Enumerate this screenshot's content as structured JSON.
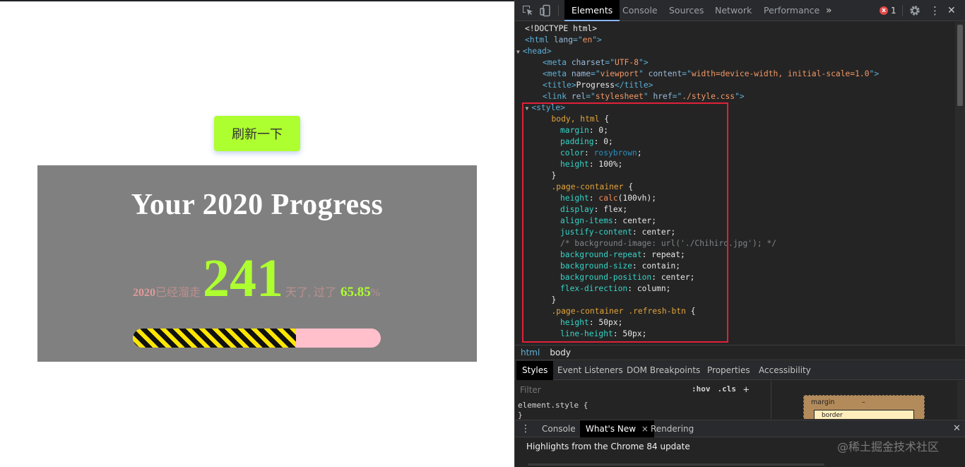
{
  "page": {
    "refresh_label": "刷新一下",
    "title": "Your 2020 Progress",
    "year": "2020",
    "elapsed_prefix": "已经溜走",
    "days": "241",
    "days_suffix": "天了, 过了",
    "percent": "65.85",
    "percent_sign": "%",
    "progress_fraction": 0.6585
  },
  "devtools": {
    "tabs": [
      "Elements",
      "Console",
      "Sources",
      "Network",
      "Performance"
    ],
    "more": "»",
    "error_count": "1",
    "error_symbol": "x",
    "more_menu": "⋮",
    "close": "✕",
    "code_lines": [
      [
        {
          "t": "<!DOCTYPE html>",
          "c": "pv"
        }
      ],
      [
        {
          "t": "<html ",
          "c": "tag"
        },
        {
          "t": "lang",
          "c": "attr"
        },
        {
          "t": "=\"",
          "c": "tag"
        },
        {
          "t": "en",
          "c": "val"
        },
        {
          "t": "\">",
          "c": "tag"
        }
      ],
      [
        {
          "t": "▼",
          "c": "arrow"
        },
        {
          "t": "<head>",
          "c": "tag"
        }
      ],
      [
        {
          "t": "<meta ",
          "c": "tag"
        },
        {
          "t": "charset",
          "c": "attr"
        },
        {
          "t": "=\"",
          "c": "tag"
        },
        {
          "t": "UTF-8",
          "c": "val"
        },
        {
          "t": "\">",
          "c": "tag"
        }
      ],
      [
        {
          "t": "<meta ",
          "c": "tag"
        },
        {
          "t": "name",
          "c": "attr"
        },
        {
          "t": "=\"",
          "c": "tag"
        },
        {
          "t": "viewport",
          "c": "val"
        },
        {
          "t": "\" ",
          "c": "tag"
        },
        {
          "t": "content",
          "c": "attr"
        },
        {
          "t": "=\"",
          "c": "tag"
        },
        {
          "t": "width=device-width, initial-scale=1.0",
          "c": "val"
        },
        {
          "t": "\">",
          "c": "tag"
        }
      ],
      [
        {
          "t": "<title>",
          "c": "tag"
        },
        {
          "t": "Progress",
          "c": "pv"
        },
        {
          "t": "</title>",
          "c": "tag"
        }
      ],
      [
        {
          "t": "<link ",
          "c": "tag"
        },
        {
          "t": "rel",
          "c": "attr"
        },
        {
          "t": "=\"",
          "c": "tag"
        },
        {
          "t": "stylesheet",
          "c": "val"
        },
        {
          "t": "\" ",
          "c": "tag"
        },
        {
          "t": "href",
          "c": "attr"
        },
        {
          "t": "=\"",
          "c": "tag"
        },
        {
          "t": "./style.css",
          "c": "val"
        },
        {
          "t": "\">",
          "c": "tag"
        }
      ],
      [
        {
          "t": "▼",
          "c": "arrow"
        },
        {
          "t": "<style>",
          "c": "tag"
        }
      ],
      [
        {
          "t": "body, html",
          "c": "sel"
        },
        {
          "t": " {",
          "c": "pv"
        }
      ],
      [
        {
          "t": "margin",
          "c": "prop"
        },
        {
          "t": ": 0;",
          "c": "pv"
        }
      ],
      [
        {
          "t": "padding",
          "c": "prop"
        },
        {
          "t": ": 0;",
          "c": "pv"
        }
      ],
      [
        {
          "t": "color",
          "c": "prop"
        },
        {
          "t": ": ",
          "c": "pv"
        },
        {
          "t": "rosybrown",
          "c": "col"
        },
        {
          "t": ";",
          "c": "pv"
        }
      ],
      [
        {
          "t": "height",
          "c": "prop"
        },
        {
          "t": ": 100%;",
          "c": "pv"
        }
      ],
      [
        {
          "t": "}",
          "c": "pv"
        }
      ],
      [
        {
          "t": ".page-container",
          "c": "sel"
        },
        {
          "t": " {",
          "c": "pv"
        }
      ],
      [
        {
          "t": "height",
          "c": "prop"
        },
        {
          "t": ": ",
          "c": "pv"
        },
        {
          "t": "calc",
          "c": "kw"
        },
        {
          "t": "(100vh);",
          "c": "pv"
        }
      ],
      [
        {
          "t": "display",
          "c": "prop"
        },
        {
          "t": ": flex;",
          "c": "pv"
        }
      ],
      [
        {
          "t": "align-items",
          "c": "prop"
        },
        {
          "t": ": center;",
          "c": "pv"
        }
      ],
      [
        {
          "t": "justify-content",
          "c": "prop"
        },
        {
          "t": ": center;",
          "c": "pv"
        }
      ],
      [
        {
          "t": "/* background-image: url('./Chihiro.jpg'); */",
          "c": "cm"
        }
      ],
      [
        {
          "t": "background-repeat",
          "c": "prop"
        },
        {
          "t": ": repeat;",
          "c": "pv"
        }
      ],
      [
        {
          "t": "background-size",
          "c": "prop"
        },
        {
          "t": ": contain;",
          "c": "pv"
        }
      ],
      [
        {
          "t": "background-position",
          "c": "prop"
        },
        {
          "t": ": center;",
          "c": "pv"
        }
      ],
      [
        {
          "t": "flex-direction",
          "c": "prop"
        },
        {
          "t": ": column;",
          "c": "pv"
        }
      ],
      [
        {
          "t": "}",
          "c": "pv"
        }
      ],
      [
        {
          "t": ".page-container .refresh-btn",
          "c": "sel"
        },
        {
          "t": " {",
          "c": "pv"
        }
      ],
      [
        {
          "t": "height",
          "c": "prop"
        },
        {
          "t": ": 50px;",
          "c": "pv"
        }
      ],
      [
        {
          "t": "line-height",
          "c": "prop"
        },
        {
          "t": ": 50px;",
          "c": "pv"
        }
      ]
    ],
    "code_indent": [
      0,
      0,
      0,
      2,
      2,
      2,
      2,
      1,
      3,
      4,
      4,
      4,
      4,
      3,
      3,
      4,
      4,
      4,
      4,
      4,
      4,
      4,
      4,
      4,
      3,
      3,
      4,
      4
    ],
    "breadcrumbs": [
      "html",
      "body"
    ],
    "sub_tabs": [
      "Styles",
      "Event Listeners",
      "DOM Breakpoints",
      "Properties",
      "Accessibility"
    ],
    "filter_placeholder": "Filter",
    "hov": ":hov",
    "cls": ".cls",
    "plus": "+",
    "element_style": "element.style {",
    "element_style_close": "}",
    "box_margin_label": "margin",
    "box_margin_value": "–",
    "box_border_label": "border",
    "drawer_tabs": [
      "Console",
      "What's New",
      "Rendering"
    ],
    "drawer_tab_close": "×",
    "drawer_headline": "Highlights from the Chrome 84 update",
    "watermark": "@稀土掘金技术社区"
  }
}
